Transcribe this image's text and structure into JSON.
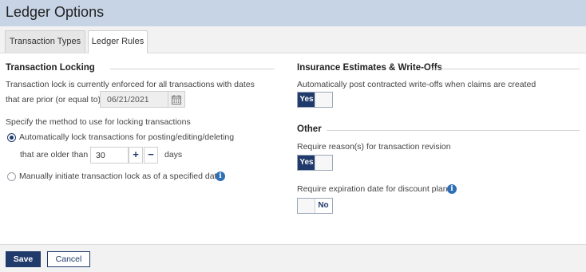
{
  "window": {
    "title": "Ledger Options"
  },
  "tabs": [
    {
      "label": "Transaction Types",
      "active": false
    },
    {
      "label": "Ledger Rules",
      "active": true
    }
  ],
  "transaction_locking": {
    "heading": "Transaction Locking",
    "status_line": "Transaction lock is currently enforced for all transactions with dates",
    "prior_label": "that are prior (or equal to)",
    "lock_date": "06/21/2021",
    "method_prompt": "Specify the method to use for locking transactions",
    "auto_option": "Automatically lock transactions for posting/editing/deleting",
    "older_than_label": "that are older than",
    "days_value": "30",
    "days_label": "days",
    "plus": "+",
    "minus": "−",
    "manual_option": "Manually initiate transaction lock as of a specified date",
    "selected_method": "auto"
  },
  "insurance": {
    "heading": "Insurance Estimates & Write-Offs",
    "auto_post_label": "Automatically post contracted write-offs when claims are created",
    "auto_post_value": "Yes"
  },
  "other": {
    "heading": "Other",
    "reason_label": "Require reason(s) for transaction revision",
    "reason_value": "Yes",
    "expiration_label": "Require expiration date for discount plans",
    "expiration_value": "No"
  },
  "footer": {
    "save": "Save",
    "cancel": "Cancel"
  },
  "icons": {
    "calendar": "calendar-icon",
    "info": "info-icon"
  },
  "colors": {
    "primary": "#1f3a6b",
    "info": "#2f6fb5",
    "header_bg": "#c7d4e5"
  }
}
